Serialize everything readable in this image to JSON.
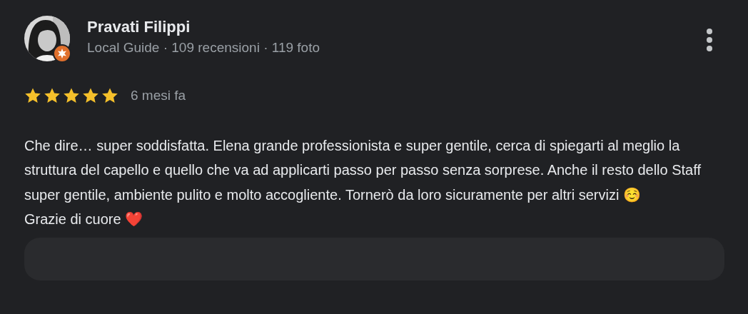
{
  "review": {
    "author": "Pravati Filippi",
    "author_meta": "Local Guide · 109 recensioni · 119 foto",
    "stars": 5,
    "time": "6 mesi fa",
    "paragraphs": [
      "Che dire… super soddisfatta. Elena grande professionista e super gentile, cerca di spiegarti al meglio la struttura del capello e quello che va ad applicarti passo per passo senza sorprese. Anche il resto dello Staff super gentile, ambiente pulito e molto accogliente. Tornerò da loro sicuramente per altri servizi ☺️",
      "Grazie di cuore ❤️"
    ]
  }
}
